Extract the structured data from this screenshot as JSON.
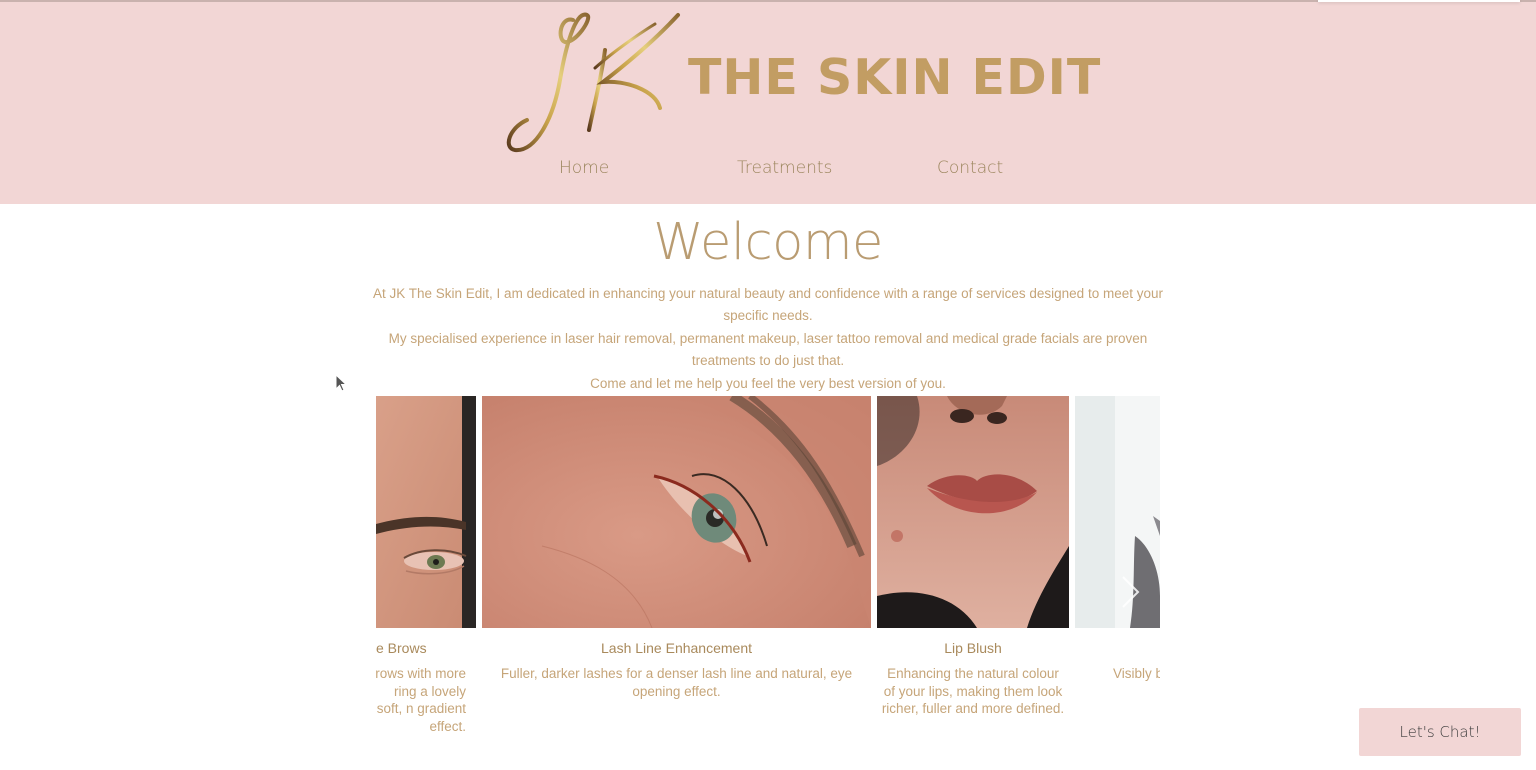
{
  "brand": {
    "monogram": "JK",
    "name": "THE SKIN EDIT"
  },
  "nav": {
    "items": [
      {
        "label": "Home"
      },
      {
        "label": "Treatments"
      },
      {
        "label": "Contact"
      }
    ]
  },
  "welcome": {
    "title": "Welcome",
    "paragraphs": [
      "At JK The Skin Edit, I am dedicated in enhancing your natural beauty and confidence with a range of services designed to meet your specific needs.",
      "My specialised experience in laser hair removal, permanent makeup, laser tattoo removal and medical grade facials are proven treatments to do just that.",
      "Come and let me help you feel the very best version of you."
    ]
  },
  "gallery": {
    "slides": [
      {
        "title": "e Brows",
        "description": "brows with more ring a lovely soft, n gradient effect."
      },
      {
        "title": "Lash Line Enhancement",
        "description": "Fuller, darker lashes for a denser lash line and natural, eye opening effect."
      },
      {
        "title": "Lip Blush",
        "description": "Enhancing the natural colour of your lips, making them look richer, fuller and more defined."
      },
      {
        "title": "",
        "description": "Visibly br"
      }
    ],
    "next_icon": "chevron-right-icon"
  },
  "chat": {
    "label": "Let's Chat!"
  },
  "colors": {
    "header_bg": "#f2d6d5",
    "brand_gold": "#c29d63",
    "nav_text": "#9c865e",
    "body_text": "#c6a579",
    "chat_bg": "#f2d6d5"
  }
}
